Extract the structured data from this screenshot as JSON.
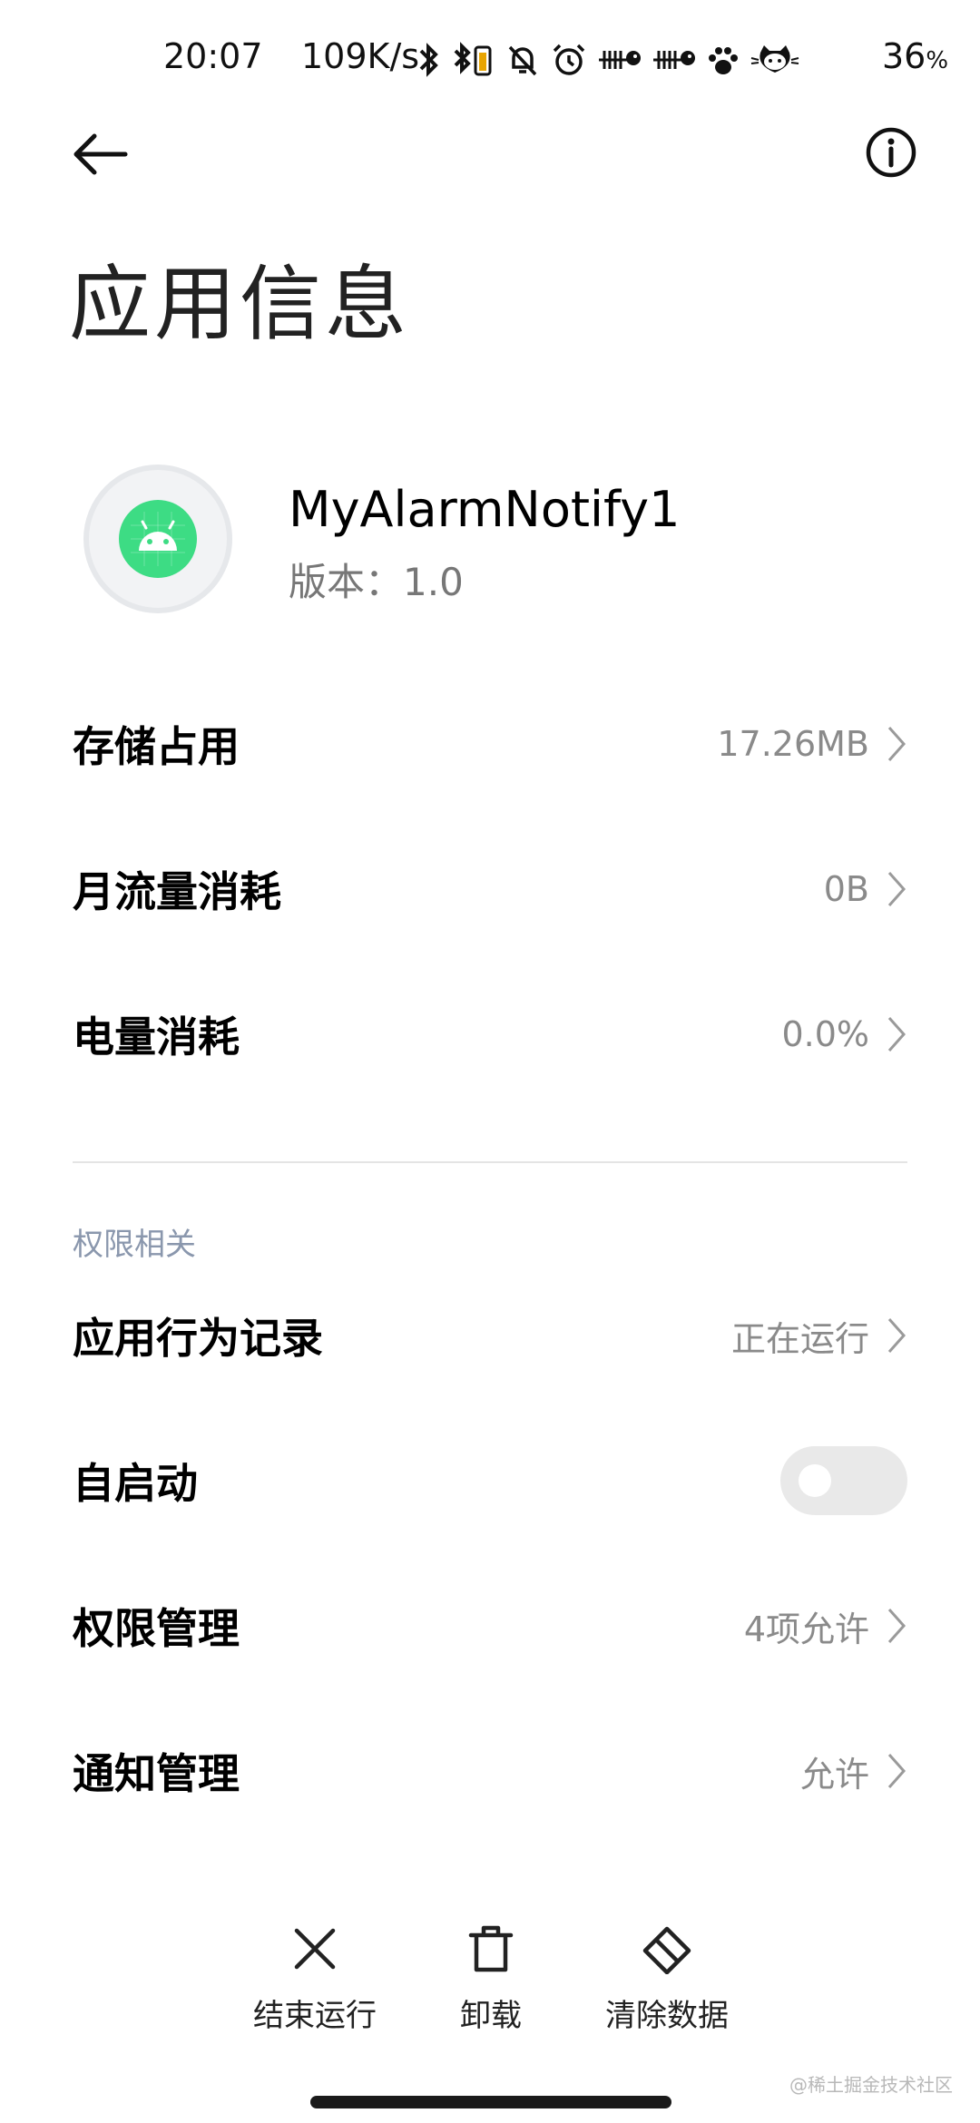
{
  "status_bar": {
    "time": "20:07",
    "net_speed": "109K/s",
    "battery_percent": "36",
    "battery_unit": "%",
    "icons": [
      "bluetooth-icon",
      "bluetooth-battery-icon",
      "mute-bell-icon",
      "alarm-icon",
      "fishbone-icon",
      "fishbone-icon",
      "paw-icon",
      "cat-icon"
    ]
  },
  "header": {
    "title": "应用信息"
  },
  "app": {
    "name": "MyAlarmNotify1",
    "version_label": "版本：",
    "version_value": "1.0",
    "icon_color": "#3ddc84"
  },
  "usage": {
    "storage_label": "存储占用",
    "storage_value": "17.26MB",
    "data_label": "月流量消耗",
    "data_value": "0B",
    "battery_label": "电量消耗",
    "battery_value": "0.0%"
  },
  "permissions": {
    "section_title": "权限相关",
    "behavior_label": "应用行为记录",
    "behavior_value": "正在运行",
    "autostart_label": "自启动",
    "autostart_enabled": false,
    "manage_label": "权限管理",
    "manage_value": "4项允许",
    "notify_label": "通知管理",
    "notify_value": "允许"
  },
  "actions": {
    "stop_label": "结束运行",
    "uninstall_label": "卸载",
    "clear_label": "清除数据"
  },
  "watermark": "@稀土掘金技术社区"
}
